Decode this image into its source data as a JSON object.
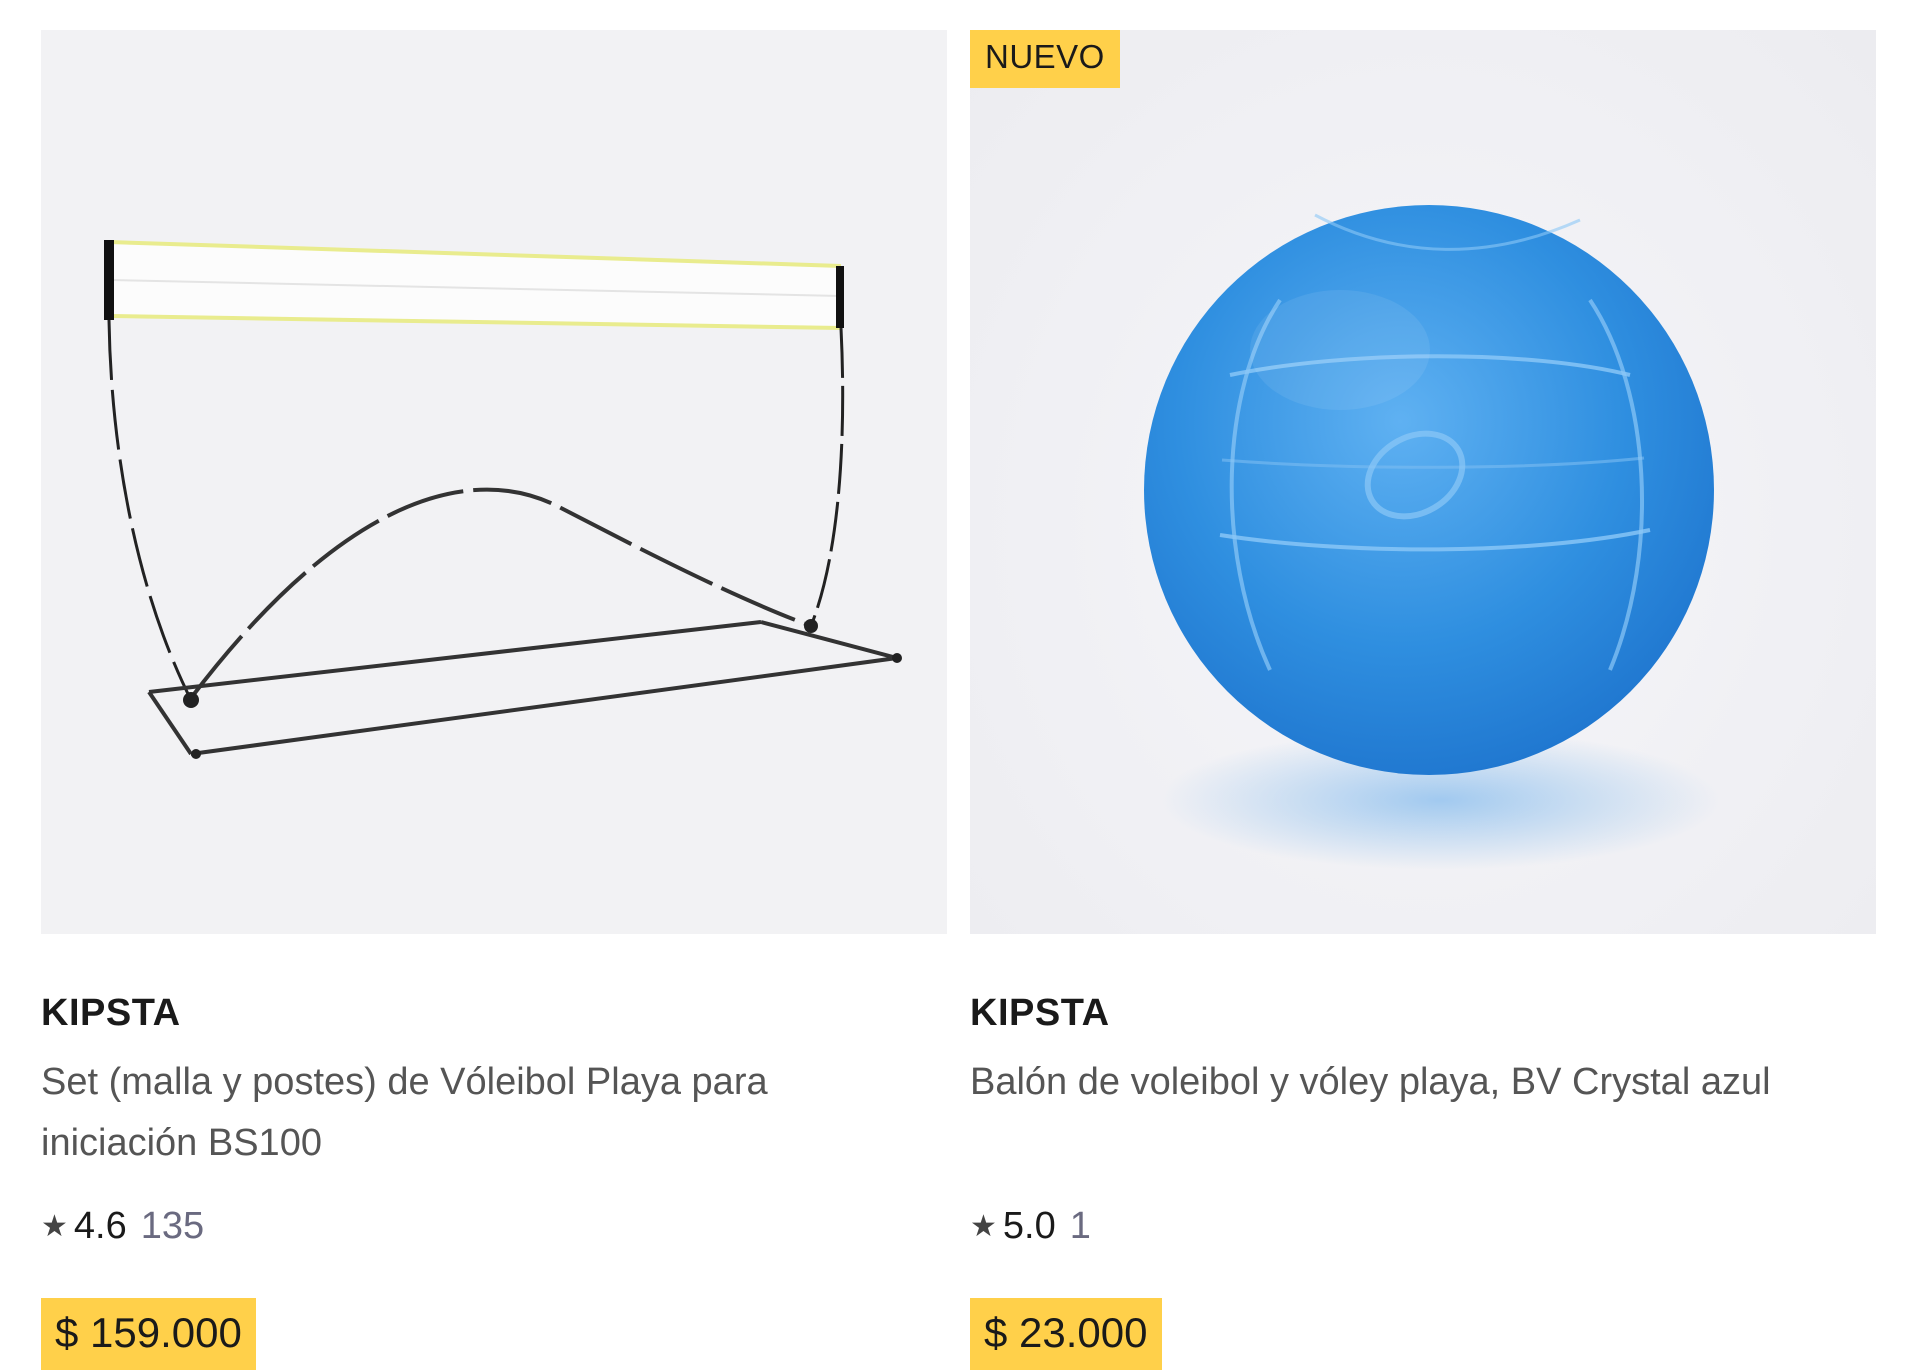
{
  "products": [
    {
      "brand": "KIPSTA",
      "title": "Set (malla y postes) de Vóleibol Playa para iniciación BS100",
      "rating_star_icon": "star-icon",
      "rating_score": "4.6",
      "rating_count": "135",
      "price": "$ 159.000",
      "image_icon": "volleyball-net-image"
    },
    {
      "badge": "NUEVO",
      "brand": "KIPSTA",
      "title": "Balón de voleibol y vóley playa, BV Crystal azul",
      "rating_star_icon": "star-icon",
      "rating_score": "5.0",
      "rating_count": "1",
      "price": "$ 23.000",
      "image_icon": "volleyball-ball-image"
    }
  ],
  "colors": {
    "badge_bg": "#ffd04a",
    "price_bg": "#ffd04a",
    "ball_blue": "#2f8fe0"
  }
}
